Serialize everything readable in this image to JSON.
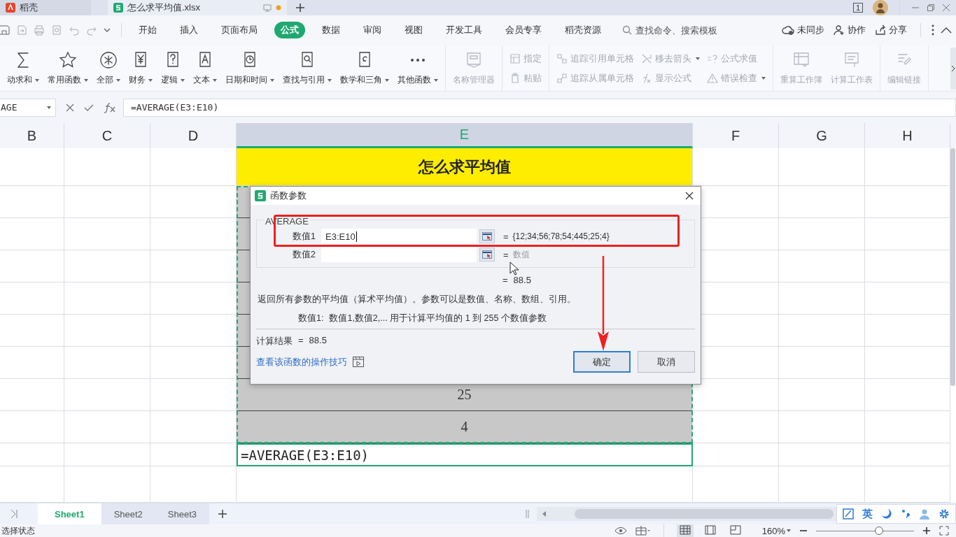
{
  "title_bar": {
    "tabs": [
      {
        "label": "稻壳",
        "kind": "docer",
        "selected": false,
        "unsaved": false
      },
      {
        "label": "怎么求平均值.xlsx",
        "kind": "sheet",
        "selected": true,
        "unsaved": true
      }
    ],
    "window_count": "1"
  },
  "menu_bar": {
    "tabs": [
      {
        "label": "开始",
        "selected": false
      },
      {
        "label": "插入",
        "selected": false
      },
      {
        "label": "页面布局",
        "selected": false
      },
      {
        "label": "公式",
        "selected": true
      },
      {
        "label": "数据",
        "selected": false
      },
      {
        "label": "审阅",
        "selected": false
      },
      {
        "label": "视图",
        "selected": false
      },
      {
        "label": "开发工具",
        "selected": false
      },
      {
        "label": "会员专享",
        "selected": false
      },
      {
        "label": "稻壳资源",
        "selected": false
      }
    ],
    "search": {
      "placeholder": "查找命令、搜索模板"
    },
    "actions": [
      {
        "label": "未同步",
        "kind": "cloud"
      },
      {
        "label": "协作",
        "kind": "user"
      },
      {
        "label": "分享",
        "kind": "share"
      }
    ]
  },
  "ribbon": {
    "groups": [
      {
        "kind": "large",
        "items": [
          {
            "label": "动求和",
            "kind": "sum",
            "dropdown": true,
            "disabled": false
          },
          {
            "label": "常用函数",
            "kind": "favorites",
            "dropdown": true,
            "disabled": false
          },
          {
            "label": "全部",
            "kind": "all",
            "dropdown": true,
            "disabled": false
          },
          {
            "label": "财务",
            "kind": "finance",
            "dropdown": true,
            "disabled": false
          },
          {
            "label": "逻辑",
            "kind": "logic",
            "dropdown": true,
            "disabled": false
          },
          {
            "label": "文本",
            "kind": "text",
            "dropdown": true,
            "disabled": false
          },
          {
            "label": "日期和时间",
            "kind": "datetime",
            "dropdown": true,
            "disabled": false
          },
          {
            "label": "查找与引用",
            "kind": "lookup",
            "dropdown": true,
            "disabled": false
          },
          {
            "label": "数学和三角",
            "kind": "math",
            "dropdown": true,
            "disabled": false
          },
          {
            "label": "其他函数",
            "kind": "more",
            "dropdown": true,
            "disabled": false
          }
        ]
      },
      {
        "kind": "large",
        "items": [
          {
            "label": "名称管理器",
            "kind": "names",
            "dropdown": false,
            "disabled": true
          }
        ]
      },
      {
        "kind": "small",
        "items": [
          {
            "label": "指定",
            "kind": "define",
            "dropdown": false,
            "disabled": true
          },
          {
            "label": "粘贴",
            "kind": "paste",
            "dropdown": false,
            "disabled": true
          }
        ]
      },
      {
        "kind": "small",
        "items": [
          {
            "label": "追踪引用单元格",
            "kind": "precedents",
            "dropdown": false,
            "disabled": true
          },
          {
            "label": "移去箭头",
            "kind": "remove",
            "dropdown": true,
            "disabled": true
          },
          {
            "label": "公式求值",
            "kind": "evaluate",
            "dropdown": false,
            "disabled": true
          },
          {
            "label": "追踪从属单元格",
            "kind": "dependents",
            "dropdown": false,
            "disabled": true
          },
          {
            "label": "显示公式",
            "kind": "show",
            "dropdown": false,
            "disabled": true
          },
          {
            "label": "错误检查",
            "kind": "errors",
            "dropdown": true,
            "disabled": true
          }
        ]
      },
      {
        "kind": "large",
        "items": [
          {
            "label": "重算工作簿",
            "kind": "recalc",
            "dropdown": false,
            "disabled": true
          },
          {
            "label": "计算工作表",
            "kind": "calcsheet",
            "dropdown": false,
            "disabled": true
          }
        ]
      },
      {
        "kind": "large",
        "items": [
          {
            "label": "编辑链接",
            "kind": "links",
            "dropdown": false,
            "disabled": true
          }
        ]
      }
    ]
  },
  "formula_bar": {
    "name_box": "AGE",
    "formula": "=AVERAGE(E3:E10)"
  },
  "sheet": {
    "columns": [
      {
        "label": "B",
        "selected": false
      },
      {
        "label": "C",
        "selected": false
      },
      {
        "label": "D",
        "selected": false
      },
      {
        "label": "E",
        "selected": true
      },
      {
        "label": "F",
        "selected": false
      },
      {
        "label": "G",
        "selected": false
      },
      {
        "label": "H",
        "selected": false
      }
    ],
    "rows": [
      {
        "kind": "title",
        "value": "怎么求平均值"
      },
      {
        "kind": "data"
      },
      {
        "kind": "data"
      },
      {
        "kind": "data"
      },
      {
        "kind": "data"
      },
      {
        "kind": "data"
      },
      {
        "kind": "data"
      },
      {
        "kind": "data",
        "value": "25"
      },
      {
        "kind": "data",
        "value": "4"
      },
      {
        "kind": "formula",
        "value": "=AVERAGE(E3:E10)"
      },
      {
        "kind": "empty"
      }
    ]
  },
  "dialog": {
    "title": "函数参数",
    "function": "AVERAGE",
    "args": [
      {
        "label": "数值1",
        "value": "E3:E10",
        "equals": "=",
        "result": "{12;34;56;78;54;445;25;4}",
        "hint": false
      },
      {
        "label": "数值2",
        "equals": "=",
        "result": "数值",
        "hint": true
      }
    ],
    "total": {
      "equals": "=",
      "value": "88.5"
    },
    "description": "返回所有参数的平均值（算术平均值）。参数可以是数值、名称、数组、引用。",
    "arg_help": {
      "label": "数值1:",
      "text": "数值1,数值2,... 用于计算平均值的 1 到 255 个数值参数"
    },
    "result": {
      "label": "计算结果",
      "equals": "=",
      "value": "88.5"
    },
    "link": "查看该函数的操作技巧",
    "buttons": [
      {
        "label": "确定",
        "default": true
      },
      {
        "label": "取消",
        "default": false
      }
    ]
  },
  "sheet_tabs": [
    {
      "label": "Sheet1",
      "selected": true
    },
    {
      "label": "Sheet2",
      "selected": false
    },
    {
      "label": "Sheet3",
      "selected": false
    }
  ],
  "ime_bar": {
    "language": "英"
  },
  "status_bar": {
    "text": "选择状态",
    "zoom": "160%",
    "zoom_slider": {
      "level": 0.64
    },
    "views": [
      {
        "selected": true
      },
      {
        "selected": false
      },
      {
        "selected": false
      }
    ]
  }
}
